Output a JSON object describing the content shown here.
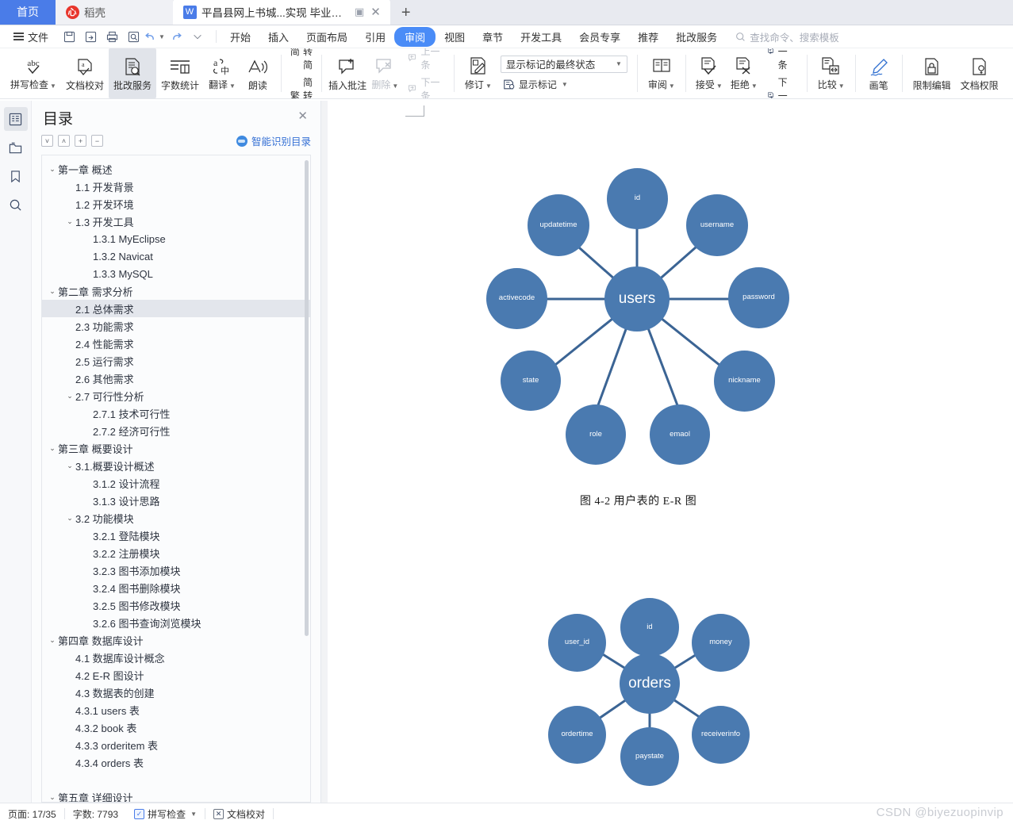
{
  "tabs": {
    "home_label": "首页",
    "docer_label": "稻壳",
    "doc_label": "平昌县网上书城...实现 毕业论文",
    "new_tab_label": "+"
  },
  "menubar": {
    "file_label": "文件",
    "quick_access": [
      "save-icon",
      "save-as-icon",
      "print-icon",
      "print-preview-icon",
      "undo-icon",
      "redo-icon",
      "customize-icon"
    ],
    "items": [
      {
        "label": "开始",
        "active": false
      },
      {
        "label": "插入",
        "active": false
      },
      {
        "label": "页面布局",
        "active": false
      },
      {
        "label": "引用",
        "active": false
      },
      {
        "label": "审阅",
        "active": true
      },
      {
        "label": "视图",
        "active": false
      },
      {
        "label": "章节",
        "active": false
      },
      {
        "label": "开发工具",
        "active": false
      },
      {
        "label": "会员专享",
        "active": false
      },
      {
        "label": "推荐",
        "active": false
      },
      {
        "label": "批改服务",
        "active": false
      }
    ],
    "search_placeholder": "查找命令、搜索模板"
  },
  "ribbon": {
    "group1": [
      {
        "label": "拼写检查",
        "icon": "abc-spell-check-icon",
        "caret": true,
        "selected": false,
        "disabled": false
      },
      {
        "label": "文档校对",
        "icon": "document-proof-icon",
        "caret": false,
        "selected": false,
        "disabled": false
      },
      {
        "label": "批改服务",
        "icon": "correction-service-icon",
        "caret": false,
        "selected": true,
        "disabled": false
      },
      {
        "label": "字数统计",
        "icon": "word-count-icon",
        "caret": false,
        "selected": false,
        "disabled": false
      },
      {
        "label": "翻译",
        "icon": "translate-icon",
        "caret": true,
        "selected": false,
        "disabled": false
      },
      {
        "label": "朗读",
        "icon": "read-aloud-icon",
        "caret": false,
        "selected": false,
        "disabled": false
      }
    ],
    "convert": [
      {
        "label": "繁转简",
        "icon": "trad-to-simp-icon"
      },
      {
        "label": "简转繁",
        "icon": "simp-to-trad-icon"
      }
    ],
    "comments": {
      "insert_label": "插入批注",
      "delete_label": "删除",
      "prev_label": "上一条",
      "next_label": "下一条"
    },
    "track": {
      "revise_label": "修订",
      "markup_state": "显示标记的最终状态",
      "show_markup_label": "显示标记"
    },
    "review_label": "审阅",
    "changes": {
      "accept_label": "接受",
      "reject_label": "拒绝",
      "prev_label": "上一条",
      "next_label": "下一条"
    },
    "compare_label": "比较",
    "pen_label": "画笔",
    "restrict_edit_label": "限制编辑",
    "doc_permission_label": "文档权限",
    "doc_truncated_label": "文"
  },
  "rail": [
    {
      "name": "outline-icon",
      "active": true
    },
    {
      "name": "thumbnail-folder-icon",
      "active": false
    },
    {
      "name": "bookmark-icon",
      "active": false
    },
    {
      "name": "search-icon",
      "active": false
    }
  ],
  "nav": {
    "title": "目录",
    "close_label": "✕",
    "tools": [
      "expand-down-icon",
      "collapse-up-icon",
      "expand-all-icon",
      "collapse-all-icon"
    ],
    "smart_toc_label": "智能识别目录",
    "items": [
      {
        "label": "第一章  概述",
        "indent": 0,
        "twisty": "v",
        "selected": false
      },
      {
        "label": "1.1  开发背景",
        "indent": 1,
        "twisty": "",
        "selected": false
      },
      {
        "label": "1.2  开发环境",
        "indent": 1,
        "twisty": "",
        "selected": false
      },
      {
        "label": "1.3  开发工具",
        "indent": 1,
        "twisty": "v",
        "selected": false
      },
      {
        "label": "1.3.1 MyEclipse",
        "indent": 2,
        "twisty": "",
        "selected": false
      },
      {
        "label": "1.3.2 Navicat",
        "indent": 2,
        "twisty": "",
        "selected": false
      },
      {
        "label": "1.3.3 MySQL",
        "indent": 2,
        "twisty": "",
        "selected": false
      },
      {
        "label": "第二章  需求分析",
        "indent": 0,
        "twisty": "v",
        "selected": false
      },
      {
        "label": "2.1  总体需求",
        "indent": 1,
        "twisty": "",
        "selected": true
      },
      {
        "label": "2.3  功能需求",
        "indent": 1,
        "twisty": "",
        "selected": false
      },
      {
        "label": "2.4  性能需求",
        "indent": 1,
        "twisty": "",
        "selected": false
      },
      {
        "label": "2.5  运行需求",
        "indent": 1,
        "twisty": "",
        "selected": false
      },
      {
        "label": "2.6  其他需求",
        "indent": 1,
        "twisty": "",
        "selected": false
      },
      {
        "label": "2.7  可行性分析",
        "indent": 1,
        "twisty": "v",
        "selected": false
      },
      {
        "label": "2.7.1 技术可行性",
        "indent": 2,
        "twisty": "",
        "selected": false
      },
      {
        "label": "2.7.2 经济可行性",
        "indent": 2,
        "twisty": "",
        "selected": false
      },
      {
        "label": "第三章  概要设计",
        "indent": 0,
        "twisty": "v",
        "selected": false
      },
      {
        "label": "3.1.概要设计概述",
        "indent": 1,
        "twisty": "v",
        "selected": false
      },
      {
        "label": "3.1.2  设计流程",
        "indent": 2,
        "twisty": "",
        "selected": false
      },
      {
        "label": "3.1.3  设计思路",
        "indent": 2,
        "twisty": "",
        "selected": false
      },
      {
        "label": "3.2  功能模块",
        "indent": 1,
        "twisty": "v",
        "selected": false
      },
      {
        "label": "3.2.1    登陆模块",
        "indent": 2,
        "twisty": "",
        "selected": false
      },
      {
        "label": "3.2.2    注册模块",
        "indent": 2,
        "twisty": "",
        "selected": false
      },
      {
        "label": "3.2.3  图书添加模块",
        "indent": 2,
        "twisty": "",
        "selected": false
      },
      {
        "label": "3.2.4  图书删除模块",
        "indent": 2,
        "twisty": "",
        "selected": false
      },
      {
        "label": "3.2.5  图书修改模块",
        "indent": 2,
        "twisty": "",
        "selected": false
      },
      {
        "label": "3.2.6  图书查询浏览模块",
        "indent": 2,
        "twisty": "",
        "selected": false
      },
      {
        "label": "第四章  数据库设计",
        "indent": 0,
        "twisty": "v",
        "selected": false
      },
      {
        "label": "4.1  数据库设计概念",
        "indent": 1,
        "twisty": "",
        "selected": false
      },
      {
        "label": "4.2 E-R 图设计",
        "indent": 1,
        "twisty": "",
        "selected": false
      },
      {
        "label": "4.3  数据表的创建",
        "indent": 1,
        "twisty": "",
        "selected": false
      },
      {
        "label": "4.3.1 users 表",
        "indent": 1,
        "twisty": "",
        "selected": false
      },
      {
        "label": "4.3.2 book 表",
        "indent": 1,
        "twisty": "",
        "selected": false
      },
      {
        "label": "4.3.3 orderitem 表",
        "indent": 1,
        "twisty": "",
        "selected": false
      },
      {
        "label": "4.3.4 orders  表",
        "indent": 1,
        "twisty": "",
        "selected": false
      },
      {
        "label": "",
        "indent": 0,
        "twisty": "",
        "selected": false
      },
      {
        "label": "第五章  详细设计",
        "indent": 0,
        "twisty": "v",
        "selected": false
      }
    ]
  },
  "document": {
    "figure1": {
      "center": "users",
      "satellites": [
        "id",
        "username",
        "password",
        "nickname",
        "emaol",
        "role",
        "state",
        "activecode",
        "updatetime"
      ],
      "caption": "图 4-2  用户表的 E-R 图"
    },
    "figure2": {
      "center": "orders",
      "satellites": [
        "id",
        "money",
        "receiverinfo",
        "paystate",
        "ordertime",
        "user_id"
      ]
    },
    "node_color": "#4a7ab0"
  },
  "statusbar": {
    "page_label": "页面: 17/35",
    "word_count_label": "字数: 7793",
    "spell_check_label": "拼写检查",
    "doc_proof_label": "文档校对"
  },
  "watermark": "CSDN @biyezuopinvip"
}
